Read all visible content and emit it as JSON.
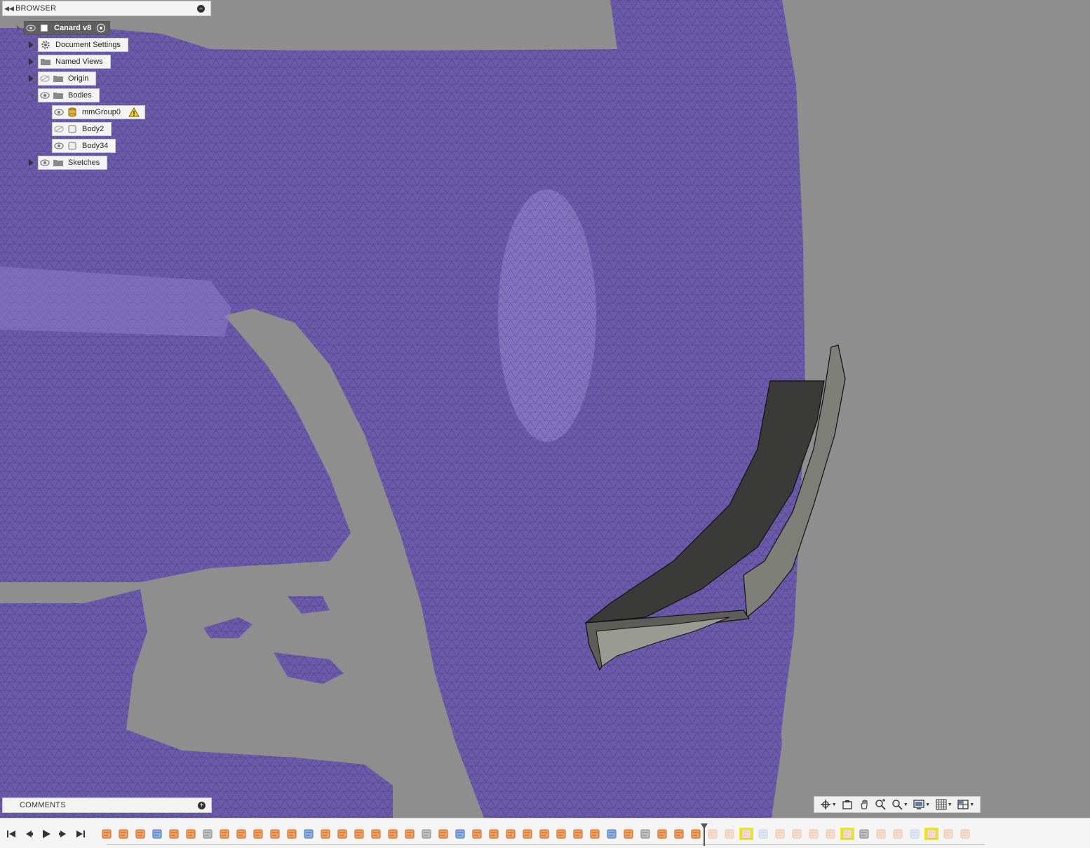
{
  "browser": {
    "title": "BROWSER",
    "root": {
      "label": "Canard v8"
    },
    "items": [
      {
        "label": "Document Settings"
      },
      {
        "label": "Named Views"
      },
      {
        "label": "Origin"
      },
      {
        "label": "Bodies"
      },
      {
        "label": "mmGroup0"
      },
      {
        "label": "Body2"
      },
      {
        "label": "Body34"
      },
      {
        "label": "Sketches"
      }
    ]
  },
  "comments": {
    "title": "COMMENTS"
  },
  "colors": {
    "mesh": "#6a5aa8",
    "background": "#8e8e8e",
    "part": "#4a4a48",
    "highlight": "#e6e62a",
    "feature": "#f0a060"
  },
  "icons": {
    "viewport_nav": [
      "orbit-icon",
      "look-at-icon",
      "pan-icon",
      "zoom-icon",
      "zoom-window-icon",
      "display-settings-icon",
      "grid-icon",
      "viewports-icon"
    ],
    "timeline_controls": [
      "go-to-start-icon",
      "step-back-icon",
      "play-icon",
      "step-forward-icon",
      "go-to-end-icon"
    ]
  }
}
